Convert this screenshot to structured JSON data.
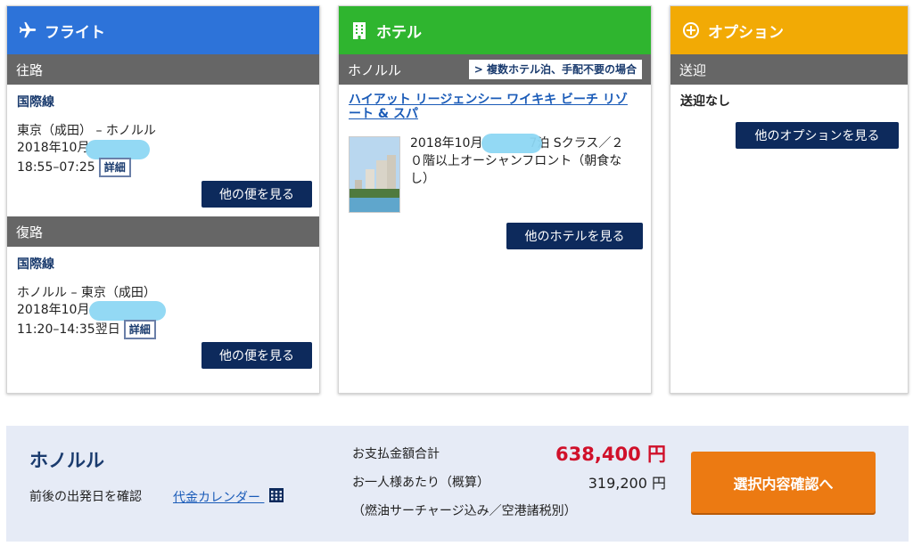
{
  "flight": {
    "header": "フライト",
    "outbound": {
      "bar": "往路",
      "type": "国際線",
      "route": "東京（成田） – ホノルル",
      "date": "2018年10月",
      "time": "18:55–07:25",
      "detail": "詳細",
      "button": "他の便を見る"
    },
    "inbound": {
      "bar": "復路",
      "type": "国際線",
      "route": "ホノルル – 東京（成田）",
      "date": "2018年10月",
      "time": "11:20–14:35翌日",
      "detail": "詳細",
      "button": "他の便を見る"
    }
  },
  "hotel": {
    "header": "ホテル",
    "city": "ホノルル",
    "multi_link": "> 複数ホテル泊、手配不要の場合",
    "name_line1": "ハイアット リージェンシー ワイキキ ビーチ リゾ",
    "name_line2": "ート & スパ",
    "desc_line1_a": "2018年10月",
    "desc_line1_b": "7泊 Sクラス／２",
    "desc_line2": "０階以上オーシャンフロント（朝食な",
    "desc_line3": "し）",
    "button": "他のホテルを見る"
  },
  "option": {
    "header": "オプション",
    "bar": "送迎",
    "transfer": "送迎なし",
    "button": "他のオプションを見る"
  },
  "summary": {
    "destination": "ホノルル",
    "check_dates": "前後の出発日を確認",
    "calendar_link": "代金カレンダー",
    "total_label": "お支払金額合計",
    "total_value": "638,400",
    "per_person_label": "お一人様あたり（概算）",
    "per_person_value": "319,200",
    "currency": "円",
    "note": "（燃油サーチャージ込み／空港諸税別）",
    "confirm_button": "選択内容確認へ"
  },
  "colors": {
    "flight": "#2d73d9",
    "hotel": "#2fb52f",
    "option": "#f2aa05",
    "navy": "#0d2a5c",
    "price_red": "#d0102a",
    "confirm": "#ec7a12"
  }
}
